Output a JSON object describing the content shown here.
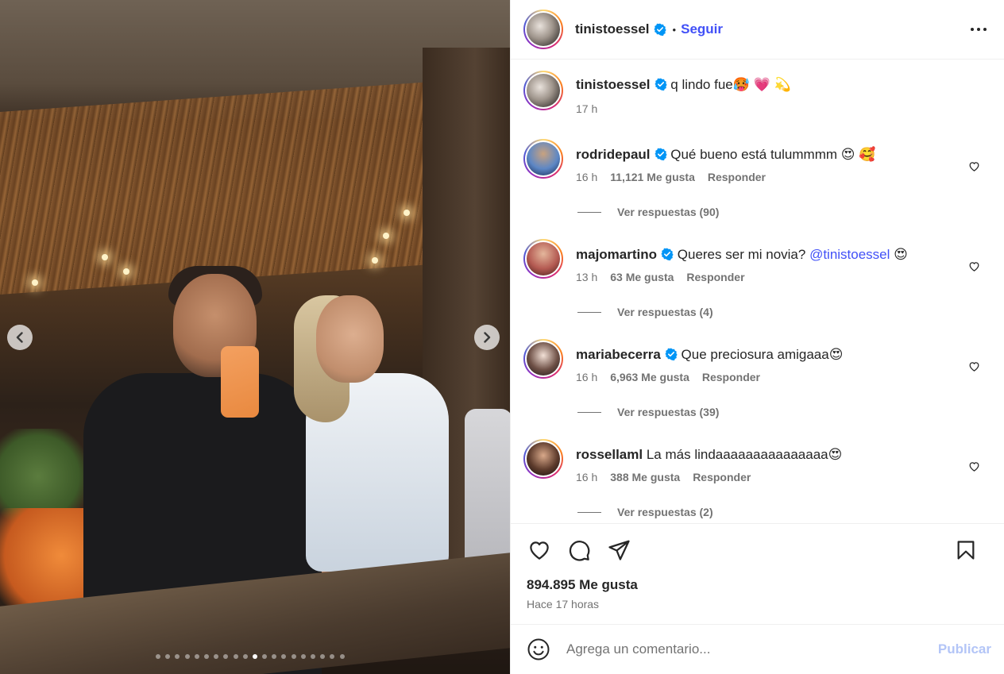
{
  "post": {
    "author": "tinistoessel",
    "follow_label": "Seguir",
    "separator": "•",
    "carousel": {
      "slides": 20,
      "active_index": 10
    }
  },
  "caption": {
    "username": "tinistoessel",
    "text": "q lindo fue🥵 💗 💫",
    "time": "17 h"
  },
  "comments": [
    {
      "username": "rodridepaul",
      "verified": true,
      "text": "Qué bueno está tulummmm 😍 🥰",
      "time": "16 h",
      "likes": "11,121 Me gusta",
      "reply": "Responder",
      "view_replies": "Ver respuestas (90)"
    },
    {
      "username": "majomartino",
      "verified": true,
      "text": "Queres ser mi novia? ",
      "mention": "@tinistoessel",
      "text_after": " 😍",
      "time": "13 h",
      "likes": "63 Me gusta",
      "reply": "Responder",
      "view_replies": "Ver respuestas (4)"
    },
    {
      "username": "mariabecerra",
      "verified": true,
      "text": "Que preciosura amigaaa😍",
      "time": "16 h",
      "likes": "6,963 Me gusta",
      "reply": "Responder",
      "view_replies": "Ver respuestas (39)"
    },
    {
      "username": "rossellaml",
      "verified": false,
      "text": "La más lindaaaaaaaaaaaaaaa😍",
      "time": "16 h",
      "likes": "388 Me gusta",
      "reply": "Responder",
      "view_replies": "Ver respuestas (2)"
    }
  ],
  "stats": {
    "likes": "894.895 Me gusta",
    "posted": "Hace 17 horas"
  },
  "compose": {
    "placeholder": "Agrega un comentario...",
    "publish_label": "Publicar"
  },
  "colors": {
    "link_blue": "#4150f7",
    "verified_blue": "#0095f6",
    "muted": "#737373",
    "publish_disabled": "#b3c5f7"
  },
  "icons": [
    "chevron-left-icon",
    "chevron-right-icon",
    "verified-icon",
    "more-icon",
    "heart-icon",
    "comment-icon",
    "share-icon",
    "bookmark-icon",
    "emoji-icon"
  ]
}
